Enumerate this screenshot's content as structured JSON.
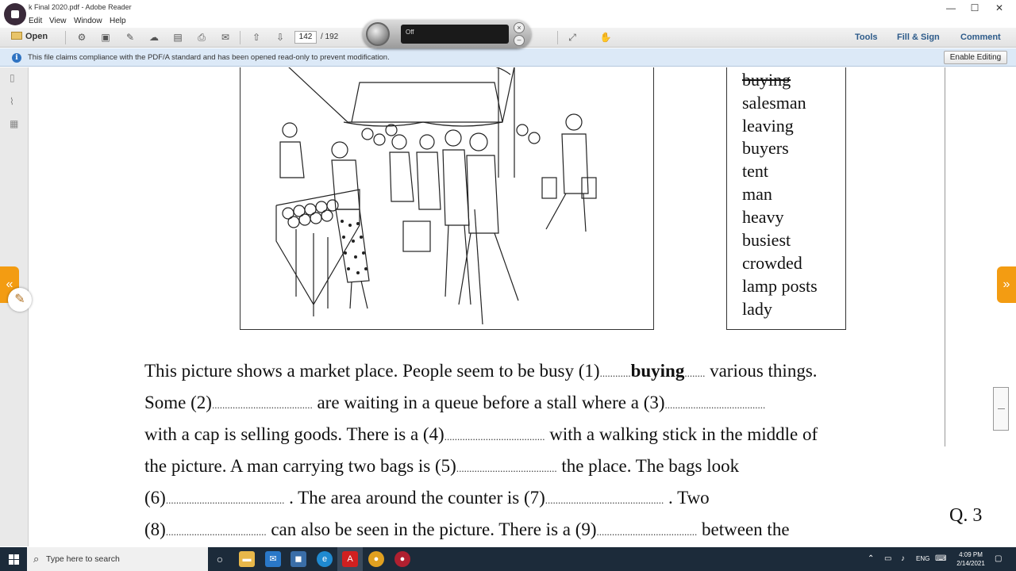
{
  "window": {
    "title": "k Final 2020.pdf - Adobe Reader",
    "minimize": "—",
    "maximize": "☐",
    "close": "✕"
  },
  "menu": [
    "Edit",
    "View",
    "Window",
    "Help"
  ],
  "toolbar": {
    "open_label": "Open",
    "current_page": "142",
    "total_pages": "/ 192",
    "tools_label": "Tools",
    "fill_sign_label": "Fill & Sign",
    "comment_label": "Comment"
  },
  "recorder": {
    "status": "Off"
  },
  "infobar": {
    "message": "This file claims compliance with the PDF/A standard and has been opened read-only to prevent modification.",
    "enable_label": "Enable Editing"
  },
  "document": {
    "word_list": [
      "buying",
      "salesman",
      "leaving",
      "buyers",
      "tent",
      "man",
      "heavy",
      "busiest",
      "crowded",
      "lamp posts",
      "lady"
    ],
    "paragraph": {
      "l1a": "This picture shows a market place. People seem to be busy (1)",
      "l1_answer": "buying",
      "l1b": " various things.",
      "l2a": "Some (2)",
      "l2b": " are waiting in a queue before a stall where a (3)",
      "l3a": "with a cap is selling goods. There is a (4)",
      "l3b": " with a walking stick in the middle of",
      "l4a": "the picture. A man carrying two bags is (5)",
      "l4b": " the place. The bags look",
      "l5a": "(6)",
      "l5b": " . The area around the counter is (7)",
      "l5c": " . Two",
      "l6a": "(8)",
      "l6b": " can also be seen in the picture. There is a (9)",
      "l6c": " between the"
    },
    "question_label": "Q. 3"
  },
  "taskbar": {
    "search_placeholder": "Type here to search",
    "tray_lang": "ENG",
    "time": "4:09 PM",
    "date": "2/14/2021"
  },
  "colors": {
    "accent_link": "#2d5b8a",
    "side_tab": "#f39c12",
    "infobar_bg": "#dce9f7",
    "taskbar_bg": "#1c2b3a"
  }
}
